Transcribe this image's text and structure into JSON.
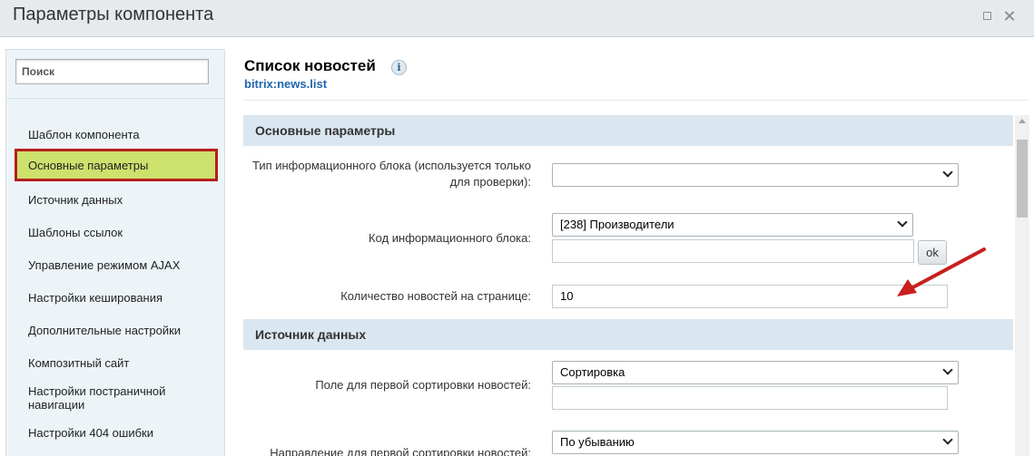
{
  "window": {
    "title": "Параметры компонента"
  },
  "sidebar": {
    "search_placeholder": "Поиск",
    "items": [
      {
        "label": "Шаблон компонента"
      },
      {
        "label": "Основные параметры"
      },
      {
        "label": "Источник данных"
      },
      {
        "label": "Шаблоны ссылок"
      },
      {
        "label": "Управление режимом AJAX"
      },
      {
        "label": "Настройки кеширования"
      },
      {
        "label": "Дополнительные настройки"
      },
      {
        "label": "Композитный сайт"
      },
      {
        "label": "Настройки постраничной навигации"
      },
      {
        "label": "Настройки 404 ошибки"
      }
    ],
    "active_item": "Основные параметры"
  },
  "main": {
    "title": "Список новостей",
    "info_glyph": "i",
    "code": "bitrix:news.list",
    "sections": [
      {
        "title": "Основные параметры"
      },
      {
        "title": "Источник данных"
      }
    ],
    "fields": {
      "iblock_type": {
        "label": "Тип информационного блока (используется только для проверки):",
        "value": ""
      },
      "iblock_code": {
        "label": "Код информационного блока:",
        "value": "[238] Производители",
        "extra_value": "",
        "ok_label": "ok"
      },
      "news_count": {
        "label": "Количество новостей на странице:",
        "value": "10"
      },
      "sort_by1": {
        "label": "Поле для первой сортировки новостей:",
        "value": "Сортировка",
        "extra_value": ""
      },
      "sort_order1": {
        "label": "Направление для первой сортировки новостей:",
        "value": "По убыванию"
      }
    }
  },
  "annotation": {
    "arrow_color": "#c8201e"
  },
  "colors": {
    "active_item_bg": "#cde16d",
    "active_item_border": "#b31f1c",
    "section_bg": "#dbe7f0",
    "link": "#2067b0"
  }
}
